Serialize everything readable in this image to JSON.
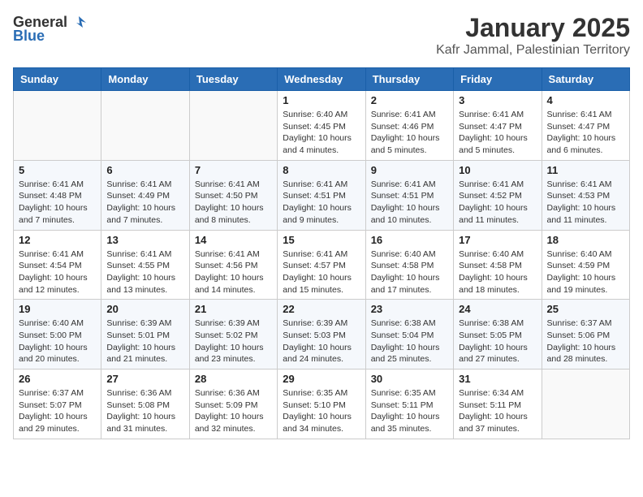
{
  "header": {
    "logo_general": "General",
    "logo_blue": "Blue",
    "month": "January 2025",
    "location": "Kafr Jammal, Palestinian Territory"
  },
  "days_of_week": [
    "Sunday",
    "Monday",
    "Tuesday",
    "Wednesday",
    "Thursday",
    "Friday",
    "Saturday"
  ],
  "weeks": [
    [
      {
        "day": "",
        "info": ""
      },
      {
        "day": "",
        "info": ""
      },
      {
        "day": "",
        "info": ""
      },
      {
        "day": "1",
        "info": "Sunrise: 6:40 AM\nSunset: 4:45 PM\nDaylight: 10 hours\nand 4 minutes."
      },
      {
        "day": "2",
        "info": "Sunrise: 6:41 AM\nSunset: 4:46 PM\nDaylight: 10 hours\nand 5 minutes."
      },
      {
        "day": "3",
        "info": "Sunrise: 6:41 AM\nSunset: 4:47 PM\nDaylight: 10 hours\nand 5 minutes."
      },
      {
        "day": "4",
        "info": "Sunrise: 6:41 AM\nSunset: 4:47 PM\nDaylight: 10 hours\nand 6 minutes."
      }
    ],
    [
      {
        "day": "5",
        "info": "Sunrise: 6:41 AM\nSunset: 4:48 PM\nDaylight: 10 hours\nand 7 minutes."
      },
      {
        "day": "6",
        "info": "Sunrise: 6:41 AM\nSunset: 4:49 PM\nDaylight: 10 hours\nand 7 minutes."
      },
      {
        "day": "7",
        "info": "Sunrise: 6:41 AM\nSunset: 4:50 PM\nDaylight: 10 hours\nand 8 minutes."
      },
      {
        "day": "8",
        "info": "Sunrise: 6:41 AM\nSunset: 4:51 PM\nDaylight: 10 hours\nand 9 minutes."
      },
      {
        "day": "9",
        "info": "Sunrise: 6:41 AM\nSunset: 4:51 PM\nDaylight: 10 hours\nand 10 minutes."
      },
      {
        "day": "10",
        "info": "Sunrise: 6:41 AM\nSunset: 4:52 PM\nDaylight: 10 hours\nand 11 minutes."
      },
      {
        "day": "11",
        "info": "Sunrise: 6:41 AM\nSunset: 4:53 PM\nDaylight: 10 hours\nand 11 minutes."
      }
    ],
    [
      {
        "day": "12",
        "info": "Sunrise: 6:41 AM\nSunset: 4:54 PM\nDaylight: 10 hours\nand 12 minutes."
      },
      {
        "day": "13",
        "info": "Sunrise: 6:41 AM\nSunset: 4:55 PM\nDaylight: 10 hours\nand 13 minutes."
      },
      {
        "day": "14",
        "info": "Sunrise: 6:41 AM\nSunset: 4:56 PM\nDaylight: 10 hours\nand 14 minutes."
      },
      {
        "day": "15",
        "info": "Sunrise: 6:41 AM\nSunset: 4:57 PM\nDaylight: 10 hours\nand 15 minutes."
      },
      {
        "day": "16",
        "info": "Sunrise: 6:40 AM\nSunset: 4:58 PM\nDaylight: 10 hours\nand 17 minutes."
      },
      {
        "day": "17",
        "info": "Sunrise: 6:40 AM\nSunset: 4:58 PM\nDaylight: 10 hours\nand 18 minutes."
      },
      {
        "day": "18",
        "info": "Sunrise: 6:40 AM\nSunset: 4:59 PM\nDaylight: 10 hours\nand 19 minutes."
      }
    ],
    [
      {
        "day": "19",
        "info": "Sunrise: 6:40 AM\nSunset: 5:00 PM\nDaylight: 10 hours\nand 20 minutes."
      },
      {
        "day": "20",
        "info": "Sunrise: 6:39 AM\nSunset: 5:01 PM\nDaylight: 10 hours\nand 21 minutes."
      },
      {
        "day": "21",
        "info": "Sunrise: 6:39 AM\nSunset: 5:02 PM\nDaylight: 10 hours\nand 23 minutes."
      },
      {
        "day": "22",
        "info": "Sunrise: 6:39 AM\nSunset: 5:03 PM\nDaylight: 10 hours\nand 24 minutes."
      },
      {
        "day": "23",
        "info": "Sunrise: 6:38 AM\nSunset: 5:04 PM\nDaylight: 10 hours\nand 25 minutes."
      },
      {
        "day": "24",
        "info": "Sunrise: 6:38 AM\nSunset: 5:05 PM\nDaylight: 10 hours\nand 27 minutes."
      },
      {
        "day": "25",
        "info": "Sunrise: 6:37 AM\nSunset: 5:06 PM\nDaylight: 10 hours\nand 28 minutes."
      }
    ],
    [
      {
        "day": "26",
        "info": "Sunrise: 6:37 AM\nSunset: 5:07 PM\nDaylight: 10 hours\nand 29 minutes."
      },
      {
        "day": "27",
        "info": "Sunrise: 6:36 AM\nSunset: 5:08 PM\nDaylight: 10 hours\nand 31 minutes."
      },
      {
        "day": "28",
        "info": "Sunrise: 6:36 AM\nSunset: 5:09 PM\nDaylight: 10 hours\nand 32 minutes."
      },
      {
        "day": "29",
        "info": "Sunrise: 6:35 AM\nSunset: 5:10 PM\nDaylight: 10 hours\nand 34 minutes."
      },
      {
        "day": "30",
        "info": "Sunrise: 6:35 AM\nSunset: 5:11 PM\nDaylight: 10 hours\nand 35 minutes."
      },
      {
        "day": "31",
        "info": "Sunrise: 6:34 AM\nSunset: 5:11 PM\nDaylight: 10 hours\nand 37 minutes."
      },
      {
        "day": "",
        "info": ""
      }
    ]
  ]
}
